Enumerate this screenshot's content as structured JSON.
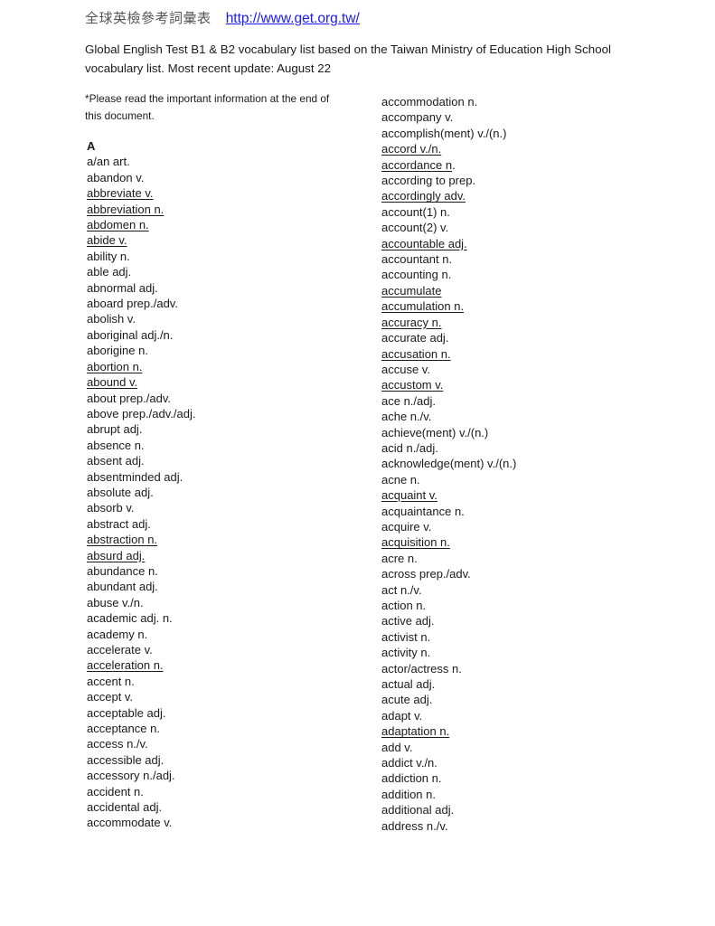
{
  "header": {
    "title_cjk": "全球英檢參考詞彙表",
    "link": "http://www.get.org.tw/"
  },
  "intro": "Global English Test B1 & B2 vocabulary list based on the Taiwan Ministry of Education High School vocabulary list. Most recent update: August 22",
  "note": "*Please read the important information at the end of this document.",
  "section_letter": "A",
  "left_column": [
    {
      "text": "a/an art.",
      "underline": false
    },
    {
      "text": "abandon v.",
      "underline": false
    },
    {
      "text": "abbreviate v.",
      "underline": true
    },
    {
      "text": "abbreviation n.",
      "underline": true
    },
    {
      "text": "abdomen n.",
      "underline": true
    },
    {
      "text": "abide v.",
      "underline": true
    },
    {
      "text": "ability n.",
      "underline": false
    },
    {
      "text": "able adj.",
      "underline": false
    },
    {
      "text": "abnormal adj.",
      "underline": false
    },
    {
      "text": "aboard prep./adv.",
      "underline": false
    },
    {
      "text": "abolish v.",
      "underline": false
    },
    {
      "text": "aboriginal adj./n.",
      "underline": false
    },
    {
      "text": "aborigine n.",
      "underline": false
    },
    {
      "text": "abortion n.",
      "underline": true
    },
    {
      "text": "abound v.",
      "underline": true
    },
    {
      "text": "about prep./adv.",
      "underline": false
    },
    {
      "text": "above prep./adv./adj.",
      "underline": false
    },
    {
      "text": "abrupt adj.",
      "underline": false
    },
    {
      "text": "absence n.",
      "underline": false
    },
    {
      "text": "absent adj.",
      "underline": false
    },
    {
      "text": "absentminded adj.",
      "underline": false
    },
    {
      "text": "absolute adj.",
      "underline": false
    },
    {
      "text": "absorb v.",
      "underline": false
    },
    {
      "text": "abstract adj.",
      "underline": false
    },
    {
      "text": "abstraction n.",
      "underline": true
    },
    {
      "text": "absurd adj.",
      "underline": true
    },
    {
      "text": "abundance n.",
      "underline": false
    },
    {
      "text": "abundant adj.",
      "underline": false
    },
    {
      "text": "abuse v./n.",
      "underline": false
    },
    {
      "text": "academic adj. n.",
      "underline": false
    },
    {
      "text": "academy n.",
      "underline": false
    },
    {
      "text": "accelerate v.",
      "underline": false
    },
    {
      "text": "acceleration n.",
      "underline": true
    },
    {
      "text": "accent n.",
      "underline": false
    },
    {
      "text": "accept v.",
      "underline": false
    },
    {
      "text": "acceptable adj.",
      "underline": false
    },
    {
      "text": "acceptance n.",
      "underline": false
    },
    {
      "text": "access n./v.",
      "underline": false
    },
    {
      "text": "accessible adj.",
      "underline": false
    },
    {
      "text": "accessory n./adj.",
      "underline": false
    },
    {
      "text": "accident n.",
      "underline": false
    },
    {
      "text": "accidental adj.",
      "underline": false
    },
    {
      "text": "accommodate v.",
      "underline": false
    }
  ],
  "right_column": [
    {
      "text": "accommodation n.",
      "underline": false
    },
    {
      "text": "accompany v.",
      "underline": false
    },
    {
      "text": "accomplish(ment) v./(n.)",
      "underline": false
    },
    {
      "text": "accord v./n.",
      "underline": true
    },
    {
      "text": "accordance n.",
      "underline": "partial",
      "underlined_part": "accordance n",
      "rest": "."
    },
    {
      "text": "according to prep.",
      "underline": false
    },
    {
      "text": "accordingly adv.",
      "underline": true
    },
    {
      "text": "account(1) n.",
      "underline": false
    },
    {
      "text": "account(2) v.",
      "underline": false
    },
    {
      "text": "accountable adj.",
      "underline": true
    },
    {
      "text": "accountant n.",
      "underline": false
    },
    {
      "text": "accounting n.",
      "underline": false
    },
    {
      "text": "accumulate",
      "underline": true
    },
    {
      "text": "accumulation n.",
      "underline": true
    },
    {
      "text": "accuracy n.",
      "underline": true
    },
    {
      "text": "accurate adj.",
      "underline": false
    },
    {
      "text": "accusation n.",
      "underline": true
    },
    {
      "text": "accuse v.",
      "underline": false
    },
    {
      "text": "accustom v.",
      "underline": true
    },
    {
      "text": "ace n./adj.",
      "underline": false
    },
    {
      "text": "ache n./v.",
      "underline": false
    },
    {
      "text": "achieve(ment) v./(n.)",
      "underline": false
    },
    {
      "text": "acid n./adj.",
      "underline": false
    },
    {
      "text": "acknowledge(ment) v./(n.)",
      "underline": false
    },
    {
      "text": "acne n.",
      "underline": false
    },
    {
      "text": "acquaint v.",
      "underline": true
    },
    {
      "text": "acquaintance n.",
      "underline": false
    },
    {
      "text": "acquire v.",
      "underline": false
    },
    {
      "text": "acquisition n.",
      "underline": true
    },
    {
      "text": "acre n.",
      "underline": false
    },
    {
      "text": "across prep./adv.",
      "underline": false
    },
    {
      "text": "act n./v.",
      "underline": false
    },
    {
      "text": "action n.",
      "underline": false
    },
    {
      "text": "active adj.",
      "underline": false
    },
    {
      "text": "activist n.",
      "underline": false
    },
    {
      "text": "activity n.",
      "underline": false
    },
    {
      "text": "actor/actress n.",
      "underline": false
    },
    {
      "text": "actual adj.",
      "underline": false
    },
    {
      "text": "acute adj.",
      "underline": false
    },
    {
      "text": "adapt v.",
      "underline": false
    },
    {
      "text": "adaptation n.",
      "underline": true
    },
    {
      "text": "add v.",
      "underline": false
    },
    {
      "text": "addict v./n.",
      "underline": false
    },
    {
      "text": "addiction n.",
      "underline": false
    },
    {
      "text": "addition n.",
      "underline": false
    },
    {
      "text": "additional adj.",
      "underline": false
    },
    {
      "text": "address n./v.",
      "underline": false
    }
  ],
  "colors": {
    "link": "#1a1aff",
    "text": "#1a1a1a",
    "cjk_title": "#555555"
  }
}
